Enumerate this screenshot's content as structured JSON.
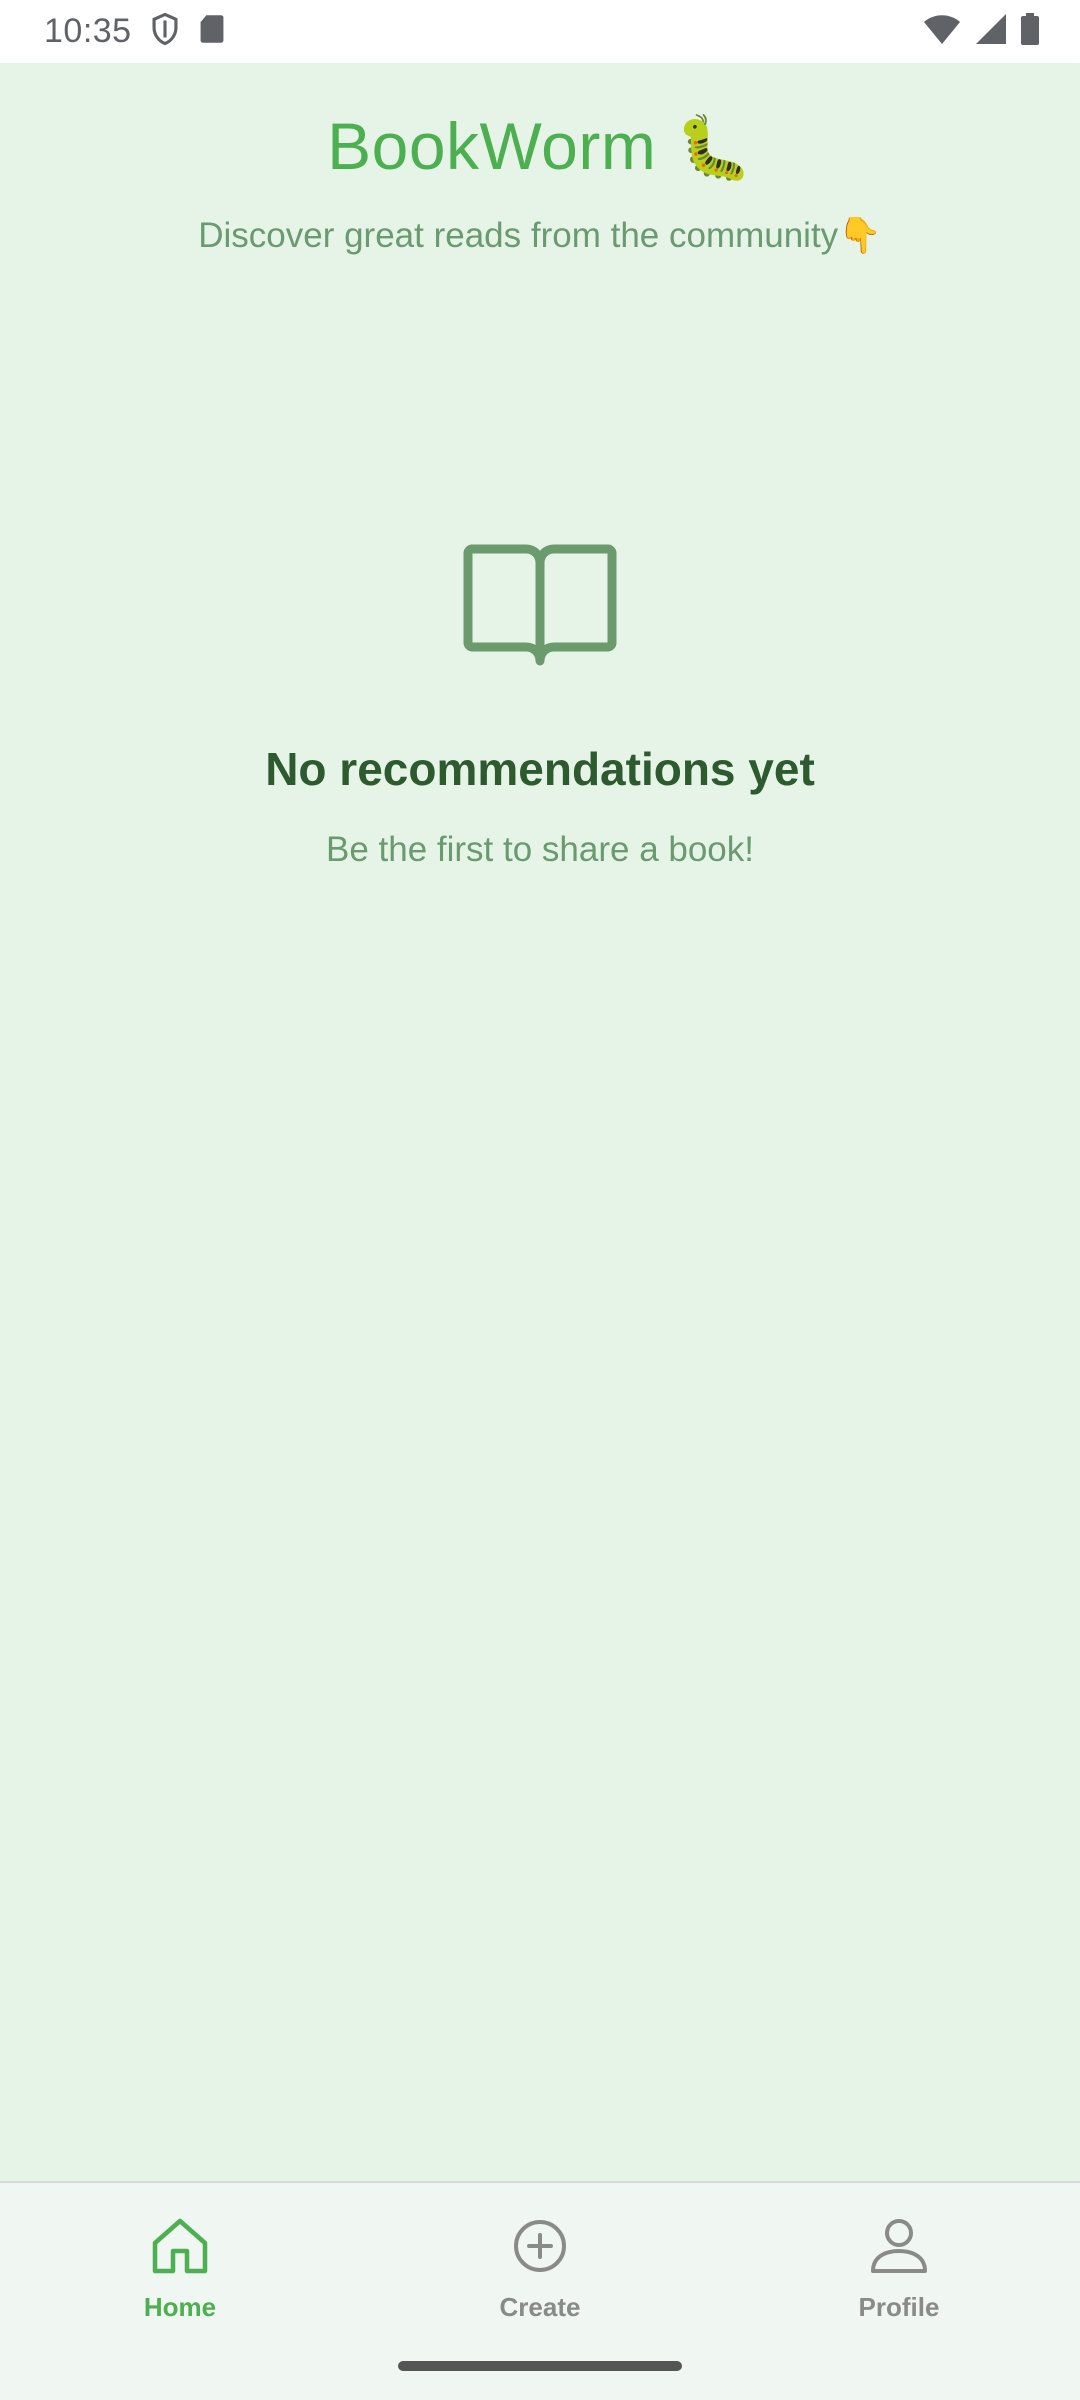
{
  "status_bar": {
    "time": "10:35",
    "icons_left": [
      "shield-icon",
      "sd-card-icon"
    ],
    "icons_right": [
      "wifi-icon",
      "signal-icon",
      "battery-icon"
    ]
  },
  "header": {
    "title": "BookWorm",
    "title_emoji": "🐛",
    "subtitle": "Discover great reads from the community👇"
  },
  "empty_state": {
    "icon": "open-book-icon",
    "title": "No recommendations yet",
    "subtitle": "Be the first to share a book!"
  },
  "bottom_nav": {
    "items": [
      {
        "label": "Home",
        "icon": "home-icon",
        "active": true
      },
      {
        "label": "Create",
        "icon": "plus-circle-icon",
        "active": false
      },
      {
        "label": "Profile",
        "icon": "person-icon",
        "active": false
      }
    ]
  },
  "colors": {
    "background": "#e6f4e7",
    "accent": "#4caf50",
    "heading": "#2e5a2f",
    "muted": "#6a9a70",
    "inactive_nav": "#8a8a8a"
  }
}
